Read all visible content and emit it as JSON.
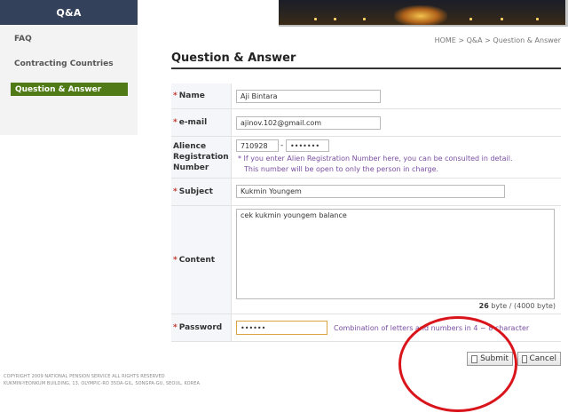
{
  "sidebar": {
    "header": "Q&A",
    "items": [
      {
        "label": "FAQ"
      },
      {
        "label": "Contracting Countries"
      },
      {
        "label": "Question & Answer"
      }
    ]
  },
  "breadcrumb": "HOME > Q&A > Question & Answer",
  "page_title": "Question & Answer",
  "form": {
    "required_mark": "*",
    "name": {
      "label": "Name",
      "value": "Aji Bintara"
    },
    "email": {
      "label": "e-mail",
      "value": "ajinov.102@gmail.com"
    },
    "registration": {
      "label_line1": "Alience",
      "label_line2": "Registration",
      "label_line3": "Number",
      "part1": "710928",
      "separator": "-",
      "part2": "•••••••",
      "note1": "* If you enter Alien Registration Number here, you can be consulted in detail.",
      "note2": "This number will be open to only the person in charge."
    },
    "subject": {
      "label": "Subject",
      "value": "Kukmin Youngem"
    },
    "content": {
      "label": "Content",
      "value": "cek kukmin youngem balance",
      "counter_value": "26",
      "counter_suffix": "byte / (4000 byte)"
    },
    "password": {
      "label": "Password",
      "value": "••••••",
      "hint": "Combination of letters and numbers in 4 ~ 8 character"
    }
  },
  "buttons": {
    "submit": "Submit",
    "cancel": "Cancel"
  },
  "footer": {
    "line1": "COPYRIGHT 2009 NATIONAL PENSION SERVICE ALL RIGHTS RESERVED",
    "line2": "KUKMIN-YEONKUM BUILDING, 13, OLYMPIC-RO 35DA-GIL, SONGPA-GU, SEOUL, KOREA"
  },
  "colors": {
    "sidebar_header": "#34415a",
    "active_item": "#4f7a16",
    "annotation": "#d9141b",
    "note": "#7a4fa0"
  }
}
